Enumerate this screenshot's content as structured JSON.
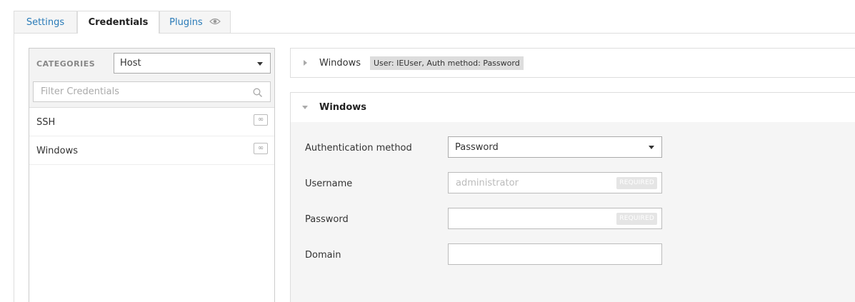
{
  "tabs": [
    {
      "label": "Settings"
    },
    {
      "label": "Credentials"
    },
    {
      "label": "Plugins"
    }
  ],
  "sidebar": {
    "categories_label": "CATEGORIES",
    "category_selected": "Host",
    "filter_placeholder": "Filter Credentials",
    "items": [
      {
        "label": "SSH",
        "badge": "∞"
      },
      {
        "label": "Windows",
        "badge": "∞"
      }
    ]
  },
  "collapsed_card": {
    "title": "Windows",
    "badge": "User: IEUser, Auth method: Password"
  },
  "expanded_card": {
    "title": "Windows",
    "fields": [
      {
        "label": "Authentication method",
        "value": "Password"
      },
      {
        "label": "Username",
        "placeholder": "administrator",
        "tag": "REQUIRED"
      },
      {
        "label": "Password",
        "placeholder": "",
        "tag": "REQUIRED"
      },
      {
        "label": "Domain",
        "placeholder": ""
      }
    ]
  },
  "colors": {
    "link_blue": "#2a7bb8",
    "panel_bg": "#f5f5f5"
  }
}
